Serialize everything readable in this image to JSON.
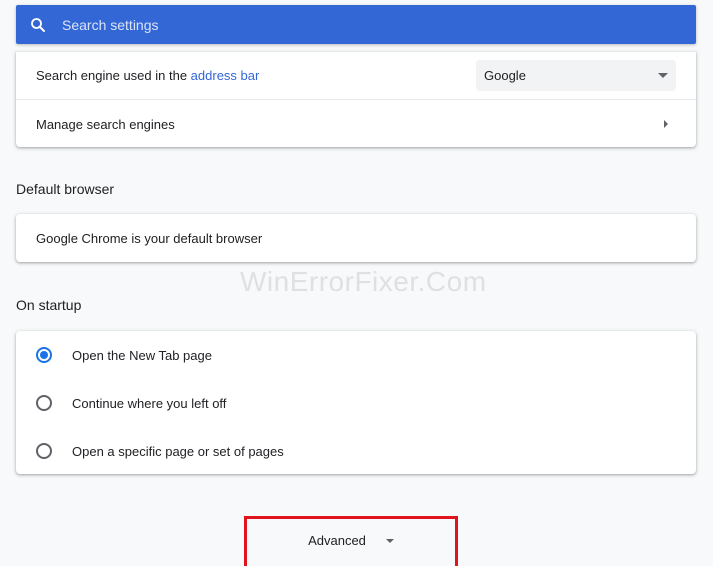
{
  "search": {
    "placeholder": "Search settings",
    "value": ""
  },
  "search_engine_section": {
    "row_label_prefix": "Search engine used in the ",
    "row_label_link": "address bar",
    "dropdown_selected": "Google",
    "manage_label": "Manage search engines"
  },
  "default_browser_section": {
    "title": "Default browser",
    "status": "Google Chrome is your default browser"
  },
  "startup_section": {
    "title": "On startup",
    "options": [
      {
        "label": "Open the New Tab page",
        "checked": true
      },
      {
        "label": "Continue where you left off",
        "checked": false
      },
      {
        "label": "Open a specific page or set of pages",
        "checked": false
      }
    ]
  },
  "advanced": {
    "label": "Advanced"
  },
  "watermark": {
    "text": "WinErrorFixer.Com"
  },
  "colors": {
    "search_bar": "#3367d6",
    "link": "#3367d6",
    "radio_checked": "#1a73e8",
    "highlight": "#e0141f",
    "background": "#f8f9fa"
  },
  "icons": {
    "search": "search-icon",
    "dropdown": "chevron-down-icon",
    "manage": "chevron-right-icon",
    "advanced": "chevron-down-icon"
  }
}
